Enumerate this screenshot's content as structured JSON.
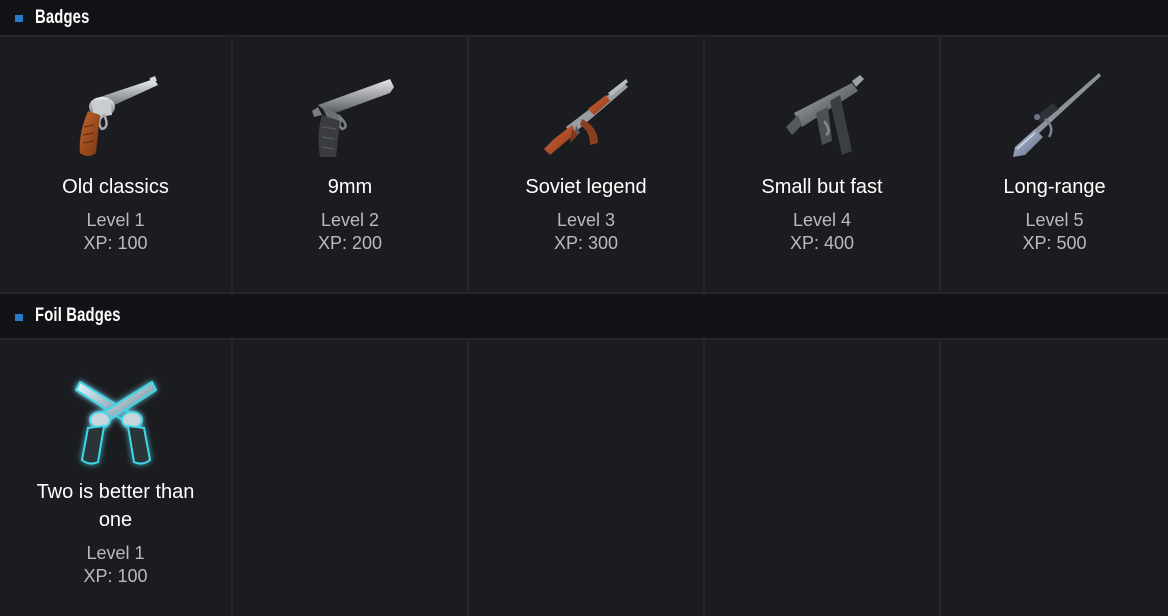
{
  "badges_section": {
    "title": "Badges",
    "items": [
      {
        "name": "Old classics",
        "level": "Level 1",
        "xp": "XP: 100",
        "icon": "revolver-icon"
      },
      {
        "name": "9mm",
        "level": "Level 2",
        "xp": "XP: 200",
        "icon": "pistol-icon"
      },
      {
        "name": "Soviet legend",
        "level": "Level 3",
        "xp": "XP: 300",
        "icon": "assault-rifle-icon"
      },
      {
        "name": "Small but fast",
        "level": "Level 4",
        "xp": "XP: 400",
        "icon": "submachine-gun-icon"
      },
      {
        "name": "Long-range",
        "level": "Level 5",
        "xp": "XP: 500",
        "icon": "sniper-rifle-icon"
      }
    ]
  },
  "foil_section": {
    "title": "Foil Badges",
    "items": [
      {
        "name": "Two is better than one",
        "level": "Level 1",
        "xp": "XP: 100",
        "icon": "crossed-revolvers-icon"
      }
    ]
  },
  "colors": {
    "background": "#1b1c20",
    "header_background": "#121316",
    "accent": "#2a78c8",
    "foil_glow": "#3fd6e8"
  }
}
